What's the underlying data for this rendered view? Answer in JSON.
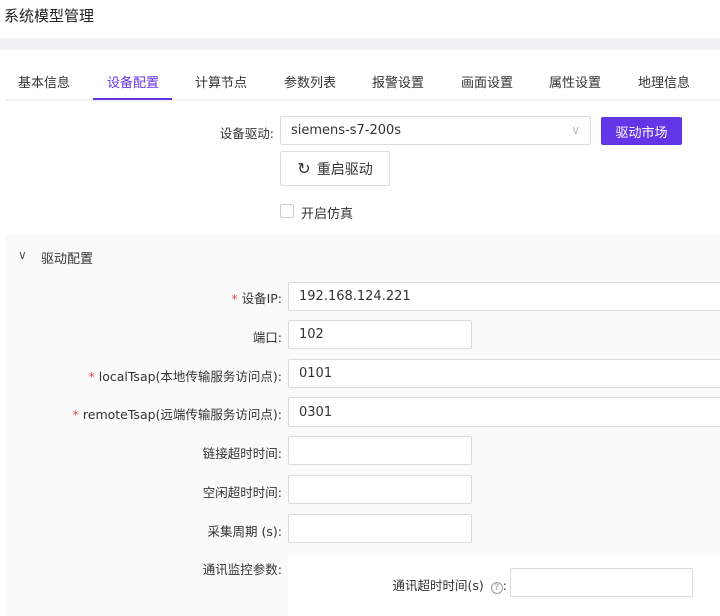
{
  "title": "系统模型管理",
  "tabs": [
    "基本信息",
    "设备配置",
    "计算节点",
    "参数列表",
    "报警设置",
    "画面设置",
    "属性设置",
    "地理信息"
  ],
  "active_tab": "设备配置",
  "driver": {
    "label": "设备驱动:",
    "value": "siemens-s7-200s",
    "market_button": "驱动市场",
    "restart_button": "重启驱动",
    "simulate_label": "开启仿真",
    "simulate_checked": false
  },
  "section": {
    "title": "驱动配置",
    "fields": [
      {
        "label": "设备IP:",
        "value": "192.168.124.221",
        "required": true
      },
      {
        "label": "端口:",
        "value": "102",
        "required": false
      },
      {
        "label": "localTsap(本地传输服务访问点):",
        "value": "0101",
        "required": true
      },
      {
        "label": "remoteTsap(远端传输服务访问点):",
        "value": "0301",
        "required": true
      },
      {
        "label": "链接超时时间:",
        "value": "",
        "required": false
      },
      {
        "label": "空闲超时时间:",
        "value": "",
        "required": false
      },
      {
        "label": "采集周期 (s):",
        "value": "",
        "required": false
      }
    ],
    "monitor": {
      "label": "通讯监控参数:",
      "timeout_label": "通讯超时时间(s)",
      "timeout_suffix": ":",
      "timeout_value": ""
    }
  },
  "required_mark": "*",
  "colors": {
    "accent": "#6236e6",
    "required": "#e34d4d"
  }
}
